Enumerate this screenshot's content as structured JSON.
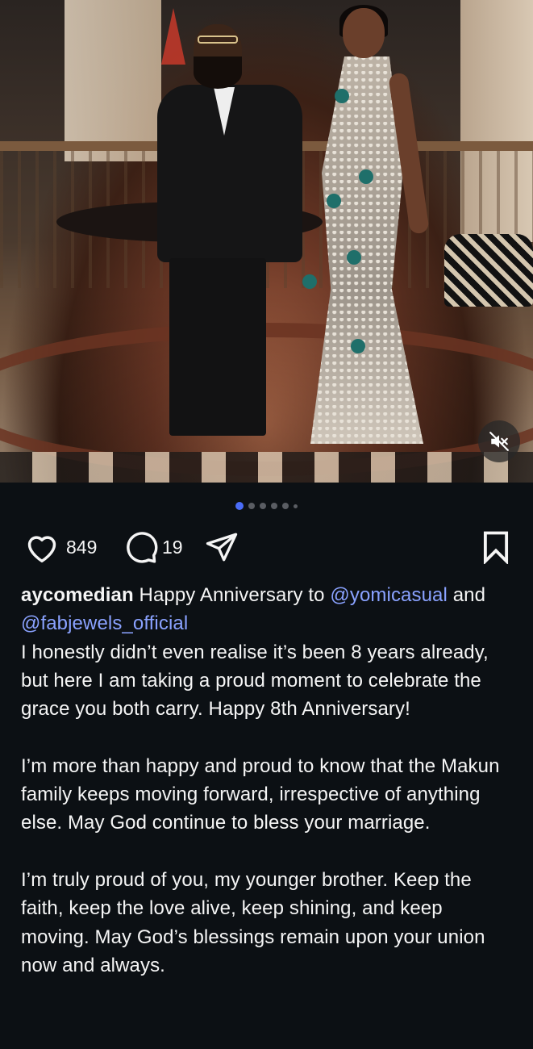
{
  "post": {
    "image_count": 6,
    "current_image": 1,
    "muted": true
  },
  "actions": {
    "likes": "849",
    "comments": "19",
    "like_icon": "heart-icon",
    "comment_icon": "comment-icon",
    "share_icon": "send-icon",
    "save_icon": "bookmark-icon"
  },
  "caption": {
    "username": "aycomedian",
    "intro": "Happy Anniversary to",
    "mention1": "@yomicasual",
    "and": "and",
    "mention2": "@fabjewels_official",
    "para1": "I honestly didn’t even realise it’s been 8 years already, but here I am taking a proud moment to celebrate the grace you both carry. Happy 8th Anniversary!",
    "para2": "I’m more than happy and proud to know that the Makun family keeps moving forward, irrespective of anything else. May God continue to bless your marriage.",
    "para3": "I’m truly proud of you, my younger brother. Keep the faith, keep the love alive, keep shining, and keep moving. May God’s blessings remain upon your union now and always."
  },
  "colors": {
    "background": "#0c1014",
    "mention": "#8aa2ff",
    "active_dot": "#4a6cf7"
  }
}
